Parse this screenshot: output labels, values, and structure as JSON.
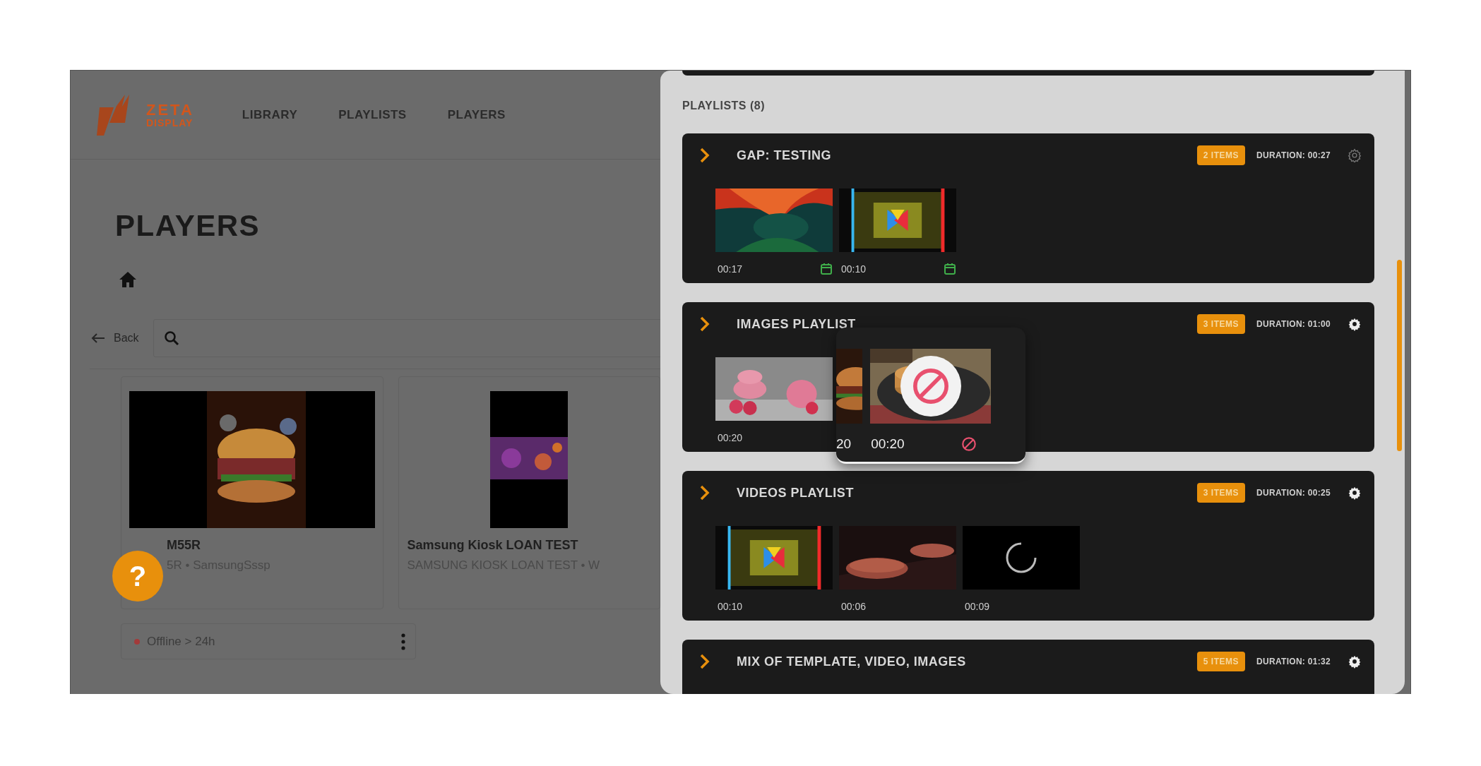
{
  "header": {
    "logo": {
      "line1": "ZETA",
      "line2": "DISPLAY"
    },
    "nav": [
      {
        "label": "LIBRARY"
      },
      {
        "label": "PLAYLISTS"
      },
      {
        "label": "PLAYERS"
      }
    ]
  },
  "page": {
    "title": "PLAYERS",
    "back": "Back"
  },
  "players": [
    {
      "name": "M55R",
      "subtitle": "5R • SamsungSssp",
      "status": {
        "label": "Offline > 24h",
        "color": "#a33a3a"
      }
    },
    {
      "name": "Samsung Kiosk LOAN TEST",
      "subtitle": "SAMSUNG KIOSK LOAN TEST • W"
    }
  ],
  "help_button": {
    "label": "?"
  },
  "panel": {
    "title": "PLAYLISTS (8)",
    "playlists": [
      {
        "name": "GAP: TESTING",
        "items_badge": "2 ITEMS",
        "duration": "DURATION: 00:27",
        "settings_disabled": true,
        "items": [
          {
            "kind": "picture",
            "duration": "00:17",
            "scheduled": true
          },
          {
            "kind": "picture",
            "duration": "00:10",
            "scheduled": true
          }
        ]
      },
      {
        "name": "IMAGES PLAYLIST",
        "items_badge": "3 ITEMS",
        "duration": "DURATION: 01:00",
        "settings_disabled": false,
        "items": [
          {
            "kind": "picture",
            "duration": "00:20",
            "scheduled": false
          }
        ]
      },
      {
        "name": "VIDEOS PLAYLIST",
        "items_badge": "3 ITEMS",
        "duration": "DURATION: 00:25",
        "settings_disabled": false,
        "items": [
          {
            "kind": "picture",
            "duration": "00:10",
            "scheduled": false
          },
          {
            "kind": "picture",
            "duration": "00:06",
            "scheduled": false
          },
          {
            "kind": "loading",
            "duration": "00:09",
            "scheduled": false
          }
        ]
      },
      {
        "name": "MIX OF TEMPLATE, VIDEO, IMAGES",
        "items_badge": "5 ITEMS",
        "duration": "DURATION: 01:32",
        "settings_disabled": false
      }
    ]
  },
  "drag_preview": {
    "partial_label": "20",
    "duration": "00:20",
    "blocked": true
  }
}
